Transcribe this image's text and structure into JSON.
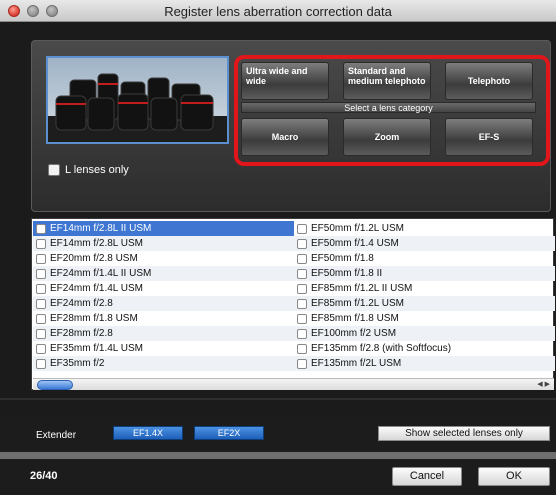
{
  "window": {
    "title": "Register lens aberration correction data"
  },
  "filters": {
    "l_lenses_only_label": "L lenses only",
    "l_lenses_only_checked": false
  },
  "categories": {
    "ultra_wide": "Ultra wide and wide",
    "standard": "Standard and medium telephoto",
    "telephoto": "Telephoto",
    "bar_label": "Select a lens category",
    "macro": "Macro",
    "zoom": "Zoom",
    "efs": "EF-S"
  },
  "lenses": {
    "left": [
      {
        "name": "EF14mm f/2.8L II USM",
        "selected": true
      },
      {
        "name": "EF14mm f/2.8L USM",
        "selected": false
      },
      {
        "name": "EF20mm f/2.8 USM",
        "selected": false
      },
      {
        "name": "EF24mm f/1.4L II USM",
        "selected": false
      },
      {
        "name": "EF24mm f/1.4L USM",
        "selected": false
      },
      {
        "name": "EF24mm f/2.8",
        "selected": false
      },
      {
        "name": "EF28mm f/1.8 USM",
        "selected": false
      },
      {
        "name": "EF28mm f/2.8",
        "selected": false
      },
      {
        "name": "EF35mm f/1.4L USM",
        "selected": false
      },
      {
        "name": "EF35mm f/2",
        "selected": false
      }
    ],
    "right": [
      {
        "name": "EF50mm f/1.2L USM",
        "selected": false
      },
      {
        "name": "EF50mm f/1.4 USM",
        "selected": false
      },
      {
        "name": "EF50mm f/1.8",
        "selected": false
      },
      {
        "name": "EF50mm f/1.8 II",
        "selected": false
      },
      {
        "name": "EF85mm f/1.2L II USM",
        "selected": false
      },
      {
        "name": "EF85mm f/1.2L USM",
        "selected": false
      },
      {
        "name": "EF85mm f/1.8 USM",
        "selected": false
      },
      {
        "name": "EF100mm f/2 USM",
        "selected": false
      },
      {
        "name": "EF135mm f/2.8 (with Softfocus)",
        "selected": false
      },
      {
        "name": "EF135mm f/2L USM",
        "selected": false
      }
    ]
  },
  "extender": {
    "label": "Extender",
    "buttons": [
      "EF1.4X",
      "EF2X"
    ]
  },
  "actions": {
    "show_selected": "Show selected lenses only",
    "cancel": "Cancel",
    "ok": "OK"
  },
  "status": {
    "count": "26/40"
  },
  "colors": {
    "accent_blue": "#3e76d1",
    "category_highlight": "#e0161a"
  }
}
